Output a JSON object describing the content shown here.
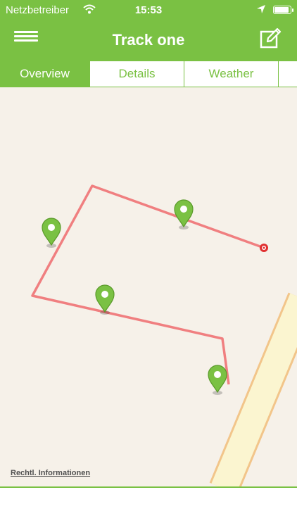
{
  "status_bar": {
    "carrier": "Netzbetreiber",
    "time": "15:53",
    "battery_level": 0.95
  },
  "nav": {
    "title": "Track one",
    "menu_icon": "hamburger-icon",
    "edit_icon": "edit-note-icon"
  },
  "tabs": [
    {
      "label": "Overview",
      "active": true
    },
    {
      "label": "Details",
      "active": false
    },
    {
      "label": "Weather",
      "active": false
    },
    {
      "label": "",
      "active": false
    }
  ],
  "map": {
    "legal_link": "Rechtl. Informationen",
    "route_color": "#f08080",
    "marker_color": "#7ac143",
    "end_marker_color": "#e03030",
    "road_color": "#f5c98a"
  },
  "colors": {
    "accent": "#7ac143"
  }
}
